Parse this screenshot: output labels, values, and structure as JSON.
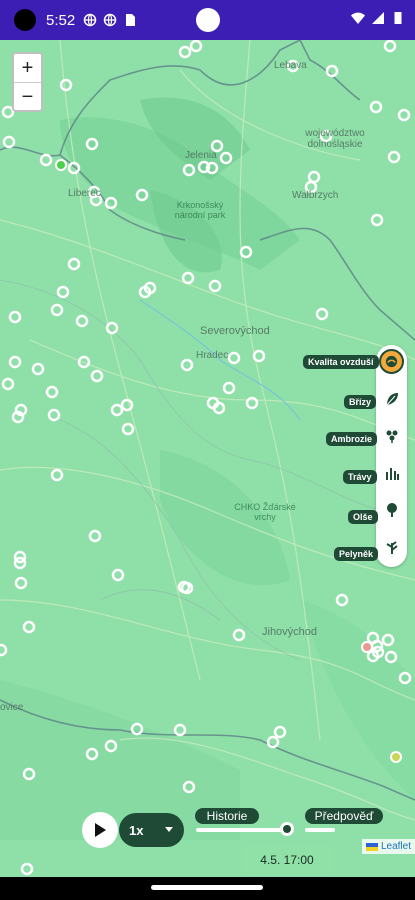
{
  "status_bar": {
    "time": "5:52",
    "left_icons": [
      "globe-icon",
      "globe-icon",
      "sd-card-icon"
    ],
    "right_icons": [
      "wifi-icon",
      "signal-icon",
      "battery-icon"
    ],
    "bg_color": "#3d1eb4"
  },
  "map": {
    "base_color": "#8fe0a8",
    "zoom": {
      "in_label": "+",
      "out_label": "−"
    },
    "places": [
      {
        "id": "lebava",
        "text": "Lebava"
      },
      {
        "id": "liberec",
        "text": "Liberec"
      },
      {
        "id": "jelenia",
        "text": "Jelenia"
      },
      {
        "id": "krkonossky",
        "text": "Krkonošský národní park"
      },
      {
        "id": "walbrzych",
        "text": "Wałbrzych"
      },
      {
        "id": "wojewodztwo",
        "text": "województwo dolnośląskie"
      },
      {
        "id": "severovychod",
        "text": "Severovýchod"
      },
      {
        "id": "hradec",
        "text": "Hradec"
      },
      {
        "id": "chko",
        "text": "CHKO Žďárské vrchy"
      },
      {
        "id": "jihovychod",
        "text": "Jihovýchod"
      },
      {
        "id": "ovice",
        "text": "ovice"
      }
    ]
  },
  "layers": [
    {
      "id": "air-quality",
      "label": "Kvalita ovzduší",
      "icon": "air-quality-icon",
      "active": true
    },
    {
      "id": "birch",
      "label": "Břízy",
      "icon": "birch-leaf-icon",
      "active": false
    },
    {
      "id": "ragweed",
      "label": "Ambrozie",
      "icon": "ragweed-icon",
      "active": false
    },
    {
      "id": "grass",
      "label": "Trávy",
      "icon": "grass-icon",
      "active": false
    },
    {
      "id": "olive",
      "label": "Olše",
      "icon": "alder-icon",
      "active": false
    },
    {
      "id": "mugwort",
      "label": "Pelyněk",
      "icon": "mugwort-icon",
      "active": false
    }
  ],
  "timeline": {
    "speed": "1x",
    "history_label": "Historie",
    "forecast_label": "Předpověď",
    "current_time": "4.5. 17:00",
    "progress": 0.92
  },
  "attribution": {
    "text": "Leaflet"
  }
}
